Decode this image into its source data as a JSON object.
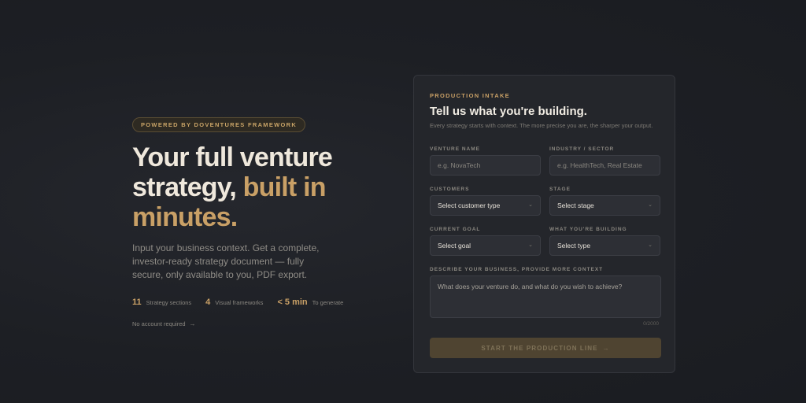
{
  "hero": {
    "badge": "POWERED BY DOVENTURES FRAMEWORK",
    "headline_1": "Your full venture",
    "headline_2": "strategy,",
    "headline_accent_1": "built in",
    "headline_accent_2": "minutes.",
    "subtext": "Input your business context. Get a complete, investor-ready strategy document — fully secure, only available to you, PDF export.",
    "stats": [
      {
        "value": "11",
        "label": "Strategy sections"
      },
      {
        "value": "4",
        "label": "Visual frameworks"
      },
      {
        "value": "< 5 min",
        "label": "To generate"
      }
    ],
    "no_account": "No account required",
    "no_account_icon": "arrow-right-icon"
  },
  "form": {
    "eyebrow": "PRODUCTION INTAKE",
    "title": "Tell us what you're building.",
    "description": "Every strategy starts with context. The more precise you are, the sharper your output.",
    "venture_name": {
      "label": "VENTURE NAME",
      "placeholder": "e.g. NovaTech",
      "value": ""
    },
    "industry": {
      "label": "INDUSTRY / SECTOR",
      "placeholder": "e.g. HealthTech, Real Estate",
      "value": ""
    },
    "customers": {
      "label": "CUSTOMERS",
      "selected": "Select customer type"
    },
    "stage": {
      "label": "STAGE",
      "selected": "Select stage"
    },
    "goal": {
      "label": "CURRENT GOAL",
      "selected": "Select goal"
    },
    "building": {
      "label": "WHAT YOU'RE BUILDING",
      "selected": "Select type"
    },
    "context": {
      "label": "DESCRIBE YOUR BUSINESS, PROVIDE MORE CONTEXT",
      "placeholder": "What does your venture do, and what do you wish to achieve?",
      "counter": "0/2000"
    },
    "submit_label": "START THE PRODUCTION LINE",
    "submit_icon": "arrow-right-icon"
  },
  "colors": {
    "accent": "#c9a066",
    "background": "#1d1f24",
    "card": "#24262b",
    "button_disabled": "#4f4431"
  }
}
